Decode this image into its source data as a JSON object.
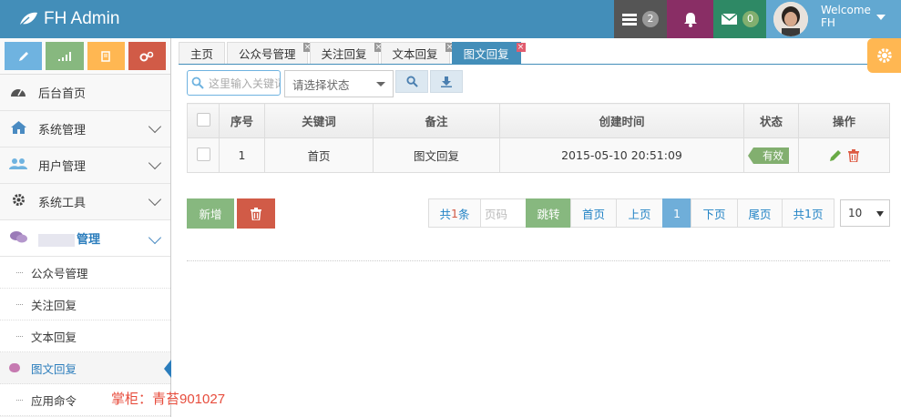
{
  "app": {
    "title": "FH Admin"
  },
  "header": {
    "task_count": "2",
    "mail_count": "0",
    "welcome": "Welcome",
    "user": "FH",
    "colors": {
      "navbar": "#438eb9",
      "tasks": "#555555",
      "notify": "#892e65",
      "mail": "#2e8965",
      "user": "#62a8d1"
    }
  },
  "sidebar": {
    "shortcuts": [
      {
        "icon": "pencil-icon",
        "color": "#6fb3e0"
      },
      {
        "icon": "signal-icon",
        "color": "#87b87f"
      },
      {
        "icon": "book-icon",
        "color": "#ffb752"
      },
      {
        "icon": "cogs-icon",
        "color": "#d15b47"
      }
    ],
    "items": [
      {
        "label": "后台首页",
        "icon": "dashboard-icon"
      },
      {
        "label": "系统管理",
        "icon": "home-icon"
      },
      {
        "label": "用户管理",
        "icon": "users-icon"
      },
      {
        "label": "系统工具",
        "icon": "cog-icon"
      },
      {
        "label": "管理",
        "icon": "comments-icon"
      }
    ],
    "subitems": [
      {
        "label": "公众号管理"
      },
      {
        "label": "关注回复"
      },
      {
        "label": "文本回复"
      },
      {
        "label": "图文回复"
      },
      {
        "label": "应用命令"
      }
    ]
  },
  "tabs": [
    {
      "label": "主页"
    },
    {
      "label": "公众号管理"
    },
    {
      "label": "关注回复"
    },
    {
      "label": "文本回复"
    },
    {
      "label": "图文回复"
    }
  ],
  "toolbar": {
    "search_placeholder": "这里输入关键词",
    "status_placeholder": "请选择状态"
  },
  "table": {
    "columns": [
      "序号",
      "关键词",
      "备注",
      "创建时间",
      "状态",
      "操作"
    ],
    "rows": [
      {
        "index": "1",
        "keyword": "首页",
        "remark": "图文回复",
        "created": "2015-05-10 20:51:09",
        "status": "有效"
      }
    ]
  },
  "actions": {
    "add_label": "新增"
  },
  "pager": {
    "total_prefix": "共",
    "total_count": "1",
    "total_suffix": "条",
    "page_input_placeholder": "页码",
    "go": "跳转",
    "first": "首页",
    "prev": "上页",
    "current": "1",
    "next": "下页",
    "last": "尾页",
    "pages_prefix": "共",
    "pages_count": "1",
    "pages_suffix": "页",
    "page_size": "10"
  },
  "watermark": "掌柜：青苔901027"
}
